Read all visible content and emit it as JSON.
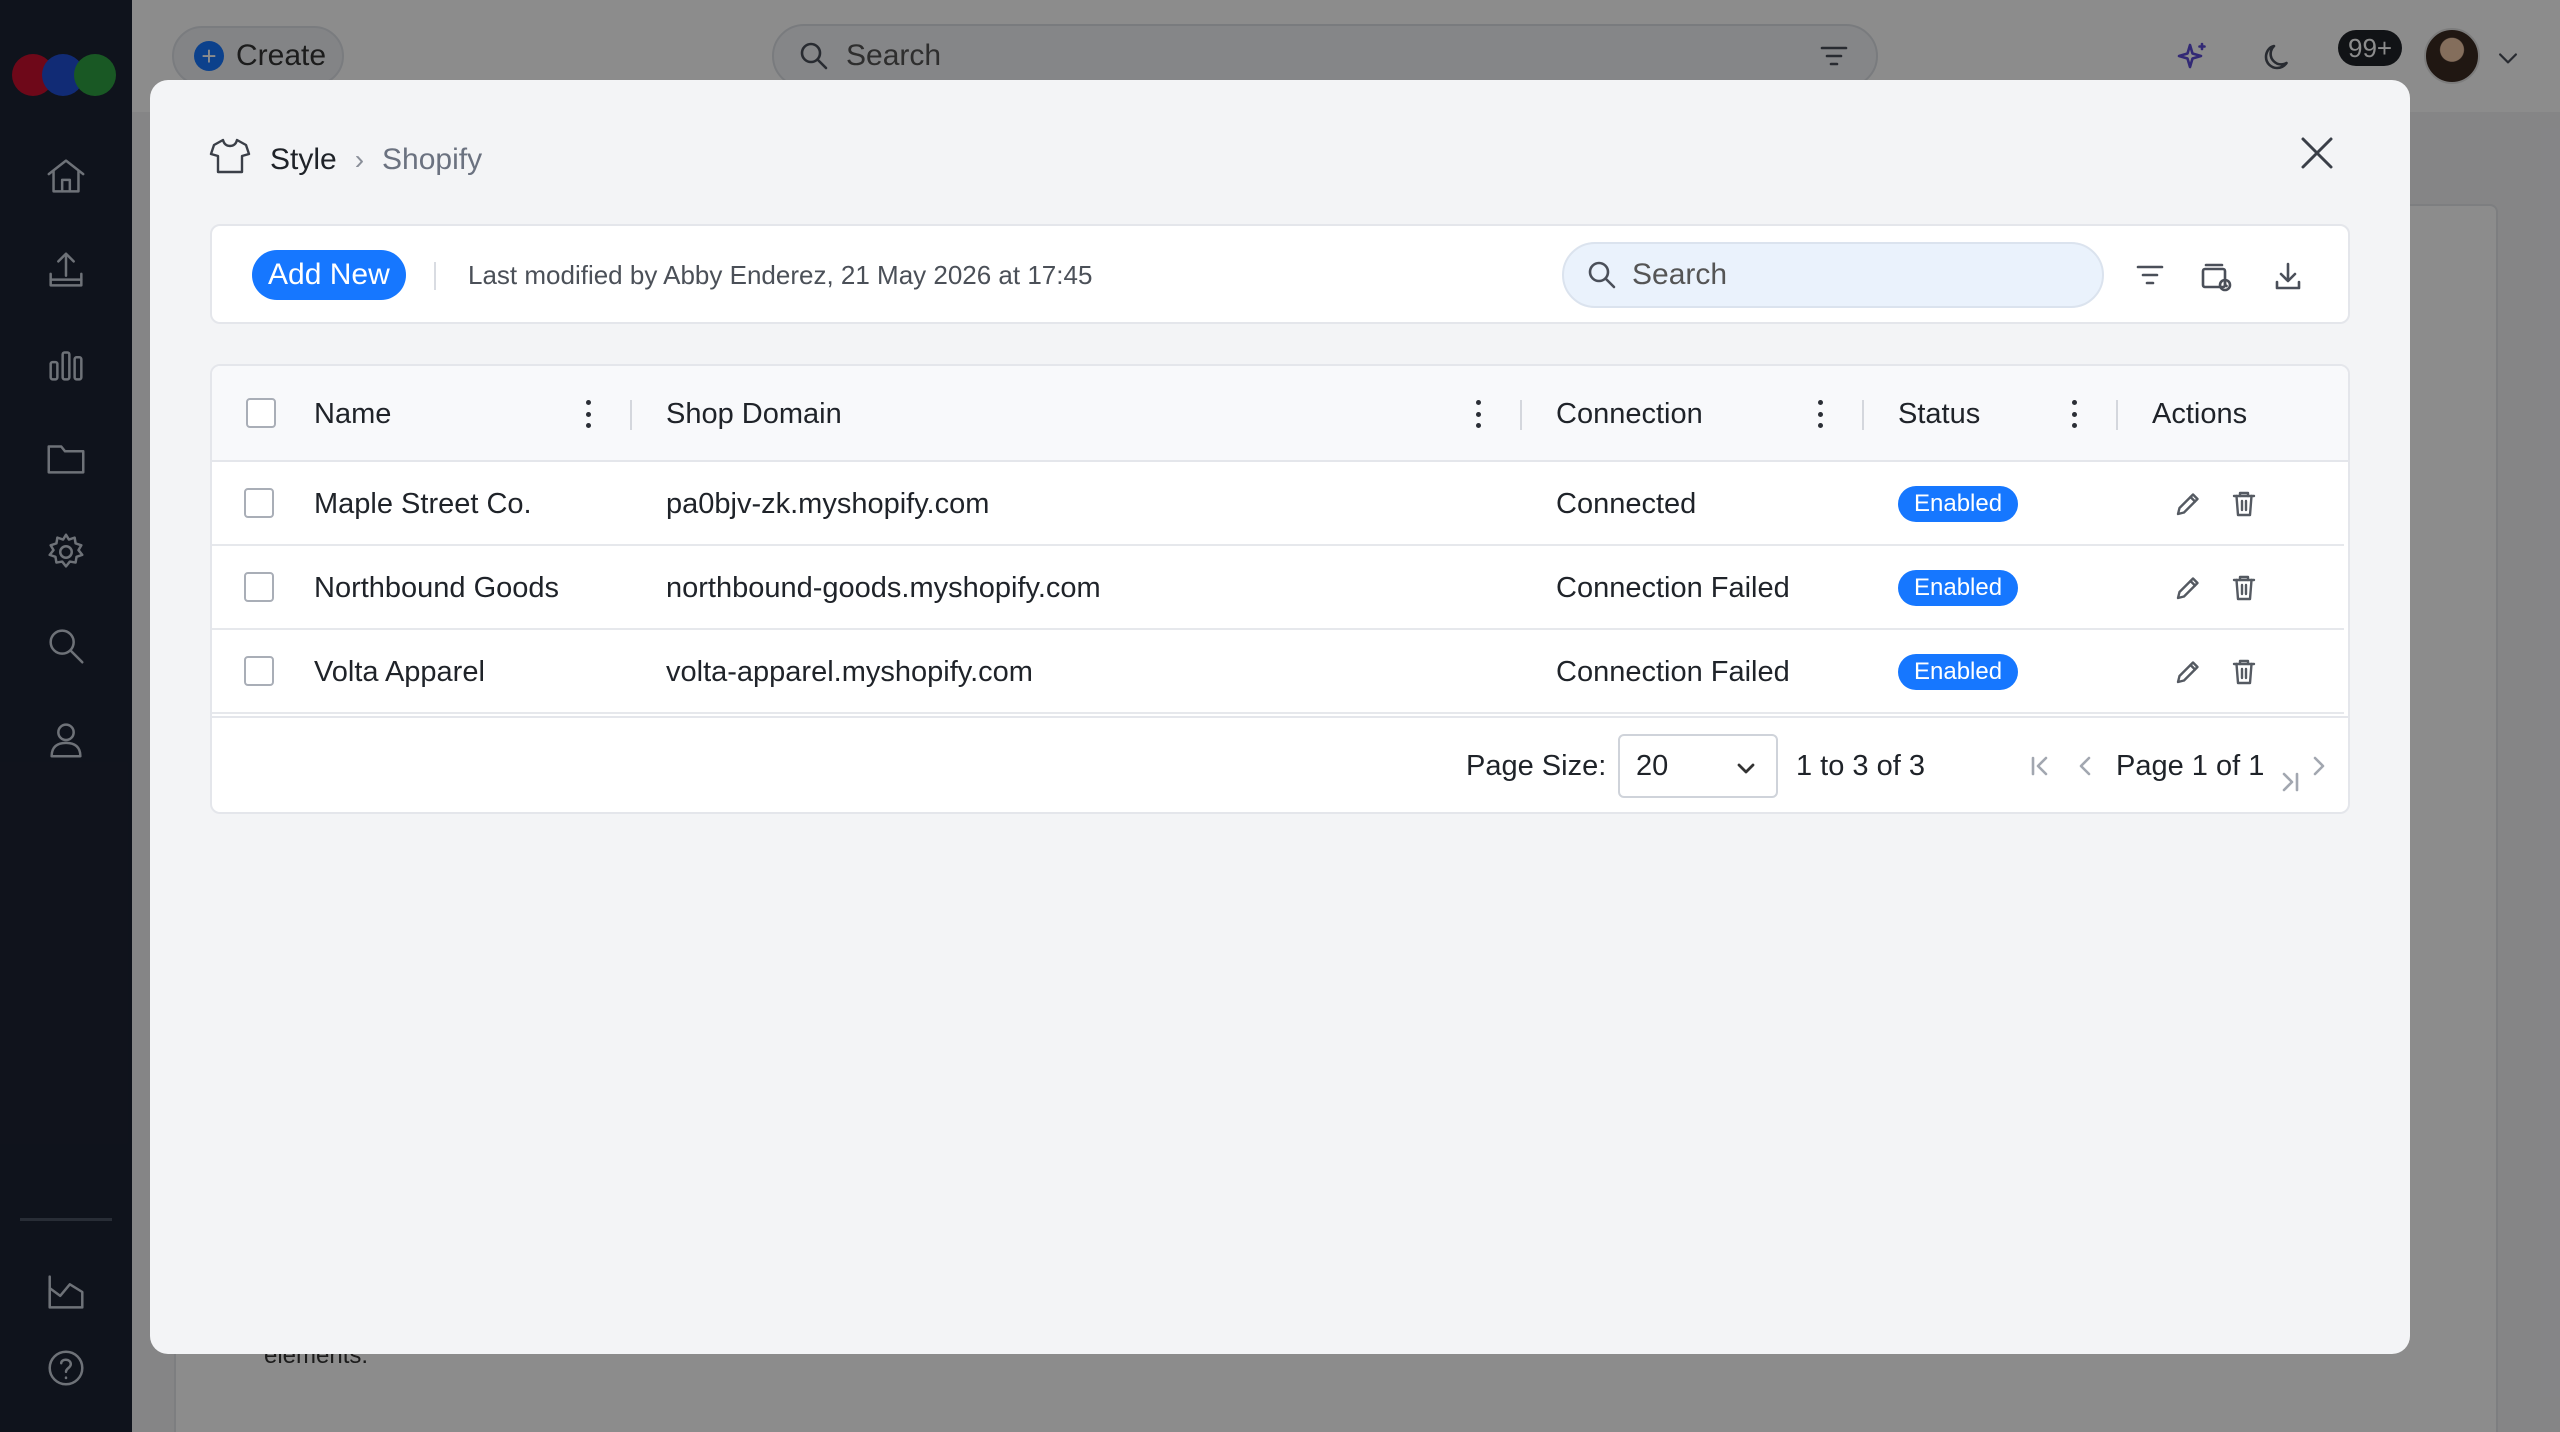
{
  "app": {
    "create_label": "Create",
    "search_placeholder": "Search",
    "notification_count": "99+",
    "background_text": "elements.",
    "sidebar_icons": [
      "home-icon",
      "upload-icon",
      "bar-chart-icon",
      "folder-icon",
      "gear-icon",
      "search-icon",
      "user-icon",
      "chart-area-icon",
      "help-icon"
    ]
  },
  "modal": {
    "breadcrumb": {
      "root": "Style",
      "separator": "›",
      "current": "Shopify"
    },
    "toolbar": {
      "add_new_label": "Add New",
      "last_modified": "Last modified by Abby Enderez, 21 May 2026 at 17:45",
      "search_placeholder": "Search"
    },
    "table": {
      "columns": [
        "Name",
        "Shop Domain",
        "Connection",
        "Status",
        "Actions"
      ],
      "rows": [
        {
          "name": "Maple Street Co.",
          "domain": "pa0bjv-zk.myshopify.com",
          "connection": "Connected",
          "status": "Enabled"
        },
        {
          "name": "Northbound Goods",
          "domain": "northbound-goods.myshopify.com",
          "connection": "Connection Failed",
          "status": "Enabled"
        },
        {
          "name": "Volta Apparel",
          "domain": "volta-apparel.myshopify.com",
          "connection": "Connection Failed",
          "status": "Enabled"
        }
      ]
    },
    "pagination": {
      "page_size_label": "Page Size:",
      "page_size": "20",
      "range": "1 to 3 of 3",
      "page_text": "Page 1 of 1"
    }
  },
  "colors": {
    "accent": "#1677ff",
    "sidebar": "#1d2333",
    "status_enabled": "#1677ff"
  }
}
